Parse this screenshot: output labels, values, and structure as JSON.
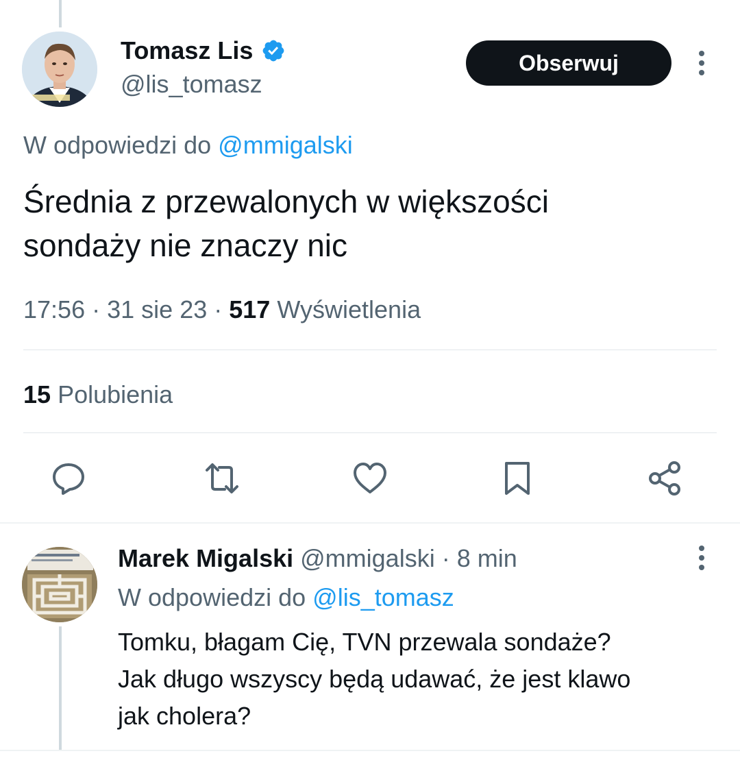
{
  "main_tweet": {
    "author_name": "Tomasz Lis",
    "author_handle": "@lis_tomasz",
    "follow_label": "Obserwuj",
    "reply_prefix": "W odpowiedzi do",
    "reply_to": "@mmigalski",
    "text_line1": "Średnia z przewalonych w większości",
    "text_line2": "sondaży nie znaczy nic",
    "time": "17:56",
    "date": "31 sie 23",
    "views_count": "517",
    "views_label": "Wyświetlenia",
    "likes_count": "15",
    "likes_label": "Polubienia"
  },
  "actions": [
    "reply-icon",
    "retweet-icon",
    "like-icon",
    "bookmark-icon",
    "share-icon"
  ],
  "reply_tweet": {
    "author_name": "Marek Migalski",
    "author_handle": "@mmigalski",
    "time_ago": "8 min",
    "reply_prefix": "W odpowiedzi do",
    "reply_to": "@lis_tomasz",
    "text_line1": "Tomku, błagam Cię, TVN przewala sondaże?",
    "text_line2": "Jak długo wszyscy będą udawać, że jest klawo",
    "text_line3": "jak cholera?"
  },
  "colors": {
    "accent": "#1d9bf0",
    "text": "#0f1419",
    "secondary": "#536471",
    "divider": "#eff3f4"
  }
}
